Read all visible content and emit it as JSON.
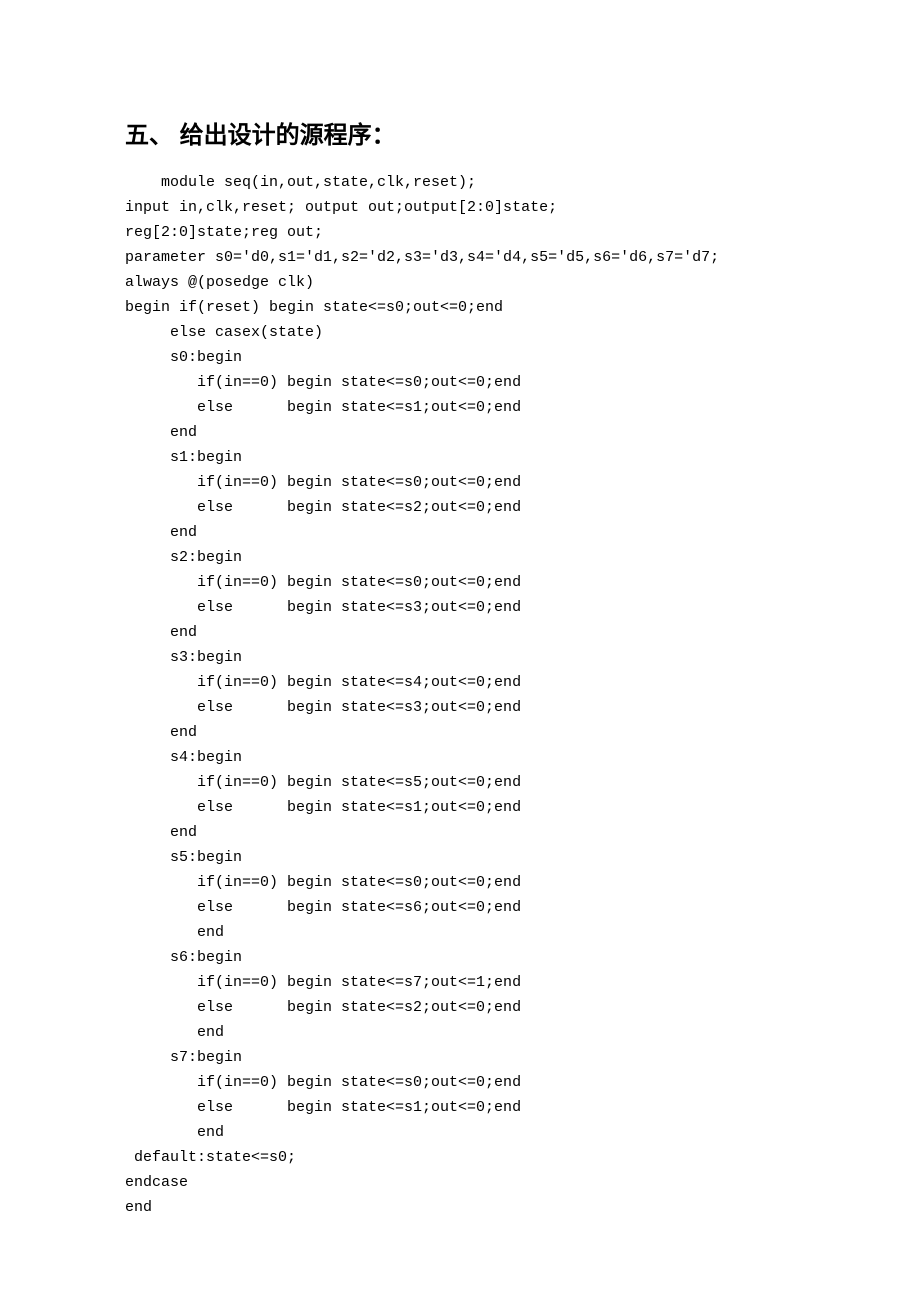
{
  "heading": "五、 给出设计的源程序：",
  "code": "    module seq(in,out,state,clk,reset);\ninput in,clk,reset; output out;output[2:0]state;\nreg[2:0]state;reg out;\nparameter s0='d0,s1='d1,s2='d2,s3='d3,s4='d4,s5='d5,s6='d6,s7='d7;\nalways @(posedge clk)\nbegin if(reset) begin state<=s0;out<=0;end\n     else casex(state)\n     s0:begin\n        if(in==0) begin state<=s0;out<=0;end\n        else      begin state<=s1;out<=0;end\n     end\n     s1:begin\n        if(in==0) begin state<=s0;out<=0;end\n        else      begin state<=s2;out<=0;end\n     end\n     s2:begin\n        if(in==0) begin state<=s0;out<=0;end\n        else      begin state<=s3;out<=0;end\n     end\n     s3:begin\n        if(in==0) begin state<=s4;out<=0;end\n        else      begin state<=s3;out<=0;end\n     end\n     s4:begin\n        if(in==0) begin state<=s5;out<=0;end\n        else      begin state<=s1;out<=0;end\n     end\n     s5:begin\n        if(in==0) begin state<=s0;out<=0;end\n        else      begin state<=s6;out<=0;end\n        end\n     s6:begin\n        if(in==0) begin state<=s7;out<=1;end\n        else      begin state<=s2;out<=0;end\n        end\n     s7:begin\n        if(in==0) begin state<=s0;out<=0;end\n        else      begin state<=s1;out<=0;end\n        end\n default:state<=s0;\nendcase\nend"
}
